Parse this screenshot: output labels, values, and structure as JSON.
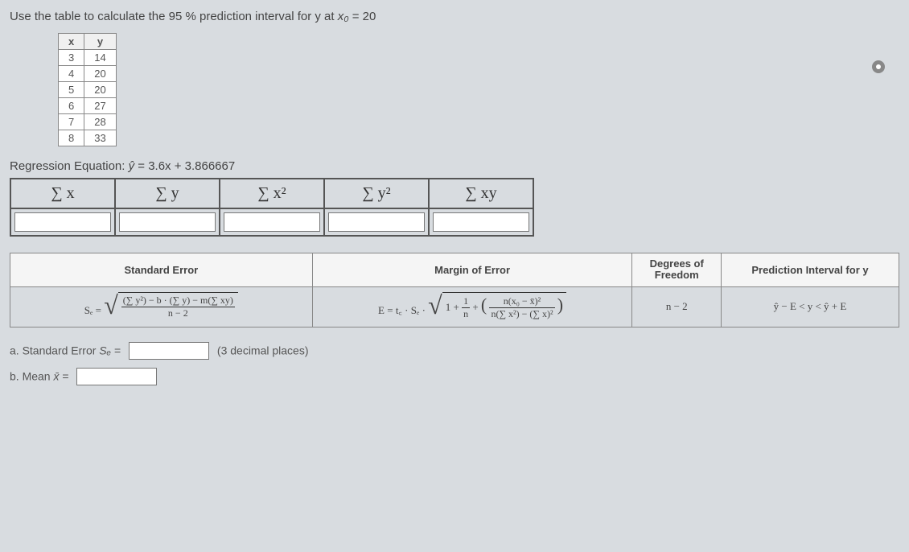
{
  "question": {
    "prefix": "Use the table to calculate the 95 % prediction interval for y at ",
    "var": "x₀",
    "equals": " = 20"
  },
  "data_table": {
    "headers": [
      "x",
      "y"
    ],
    "rows": [
      [
        "3",
        "14"
      ],
      [
        "4",
        "20"
      ],
      [
        "5",
        "20"
      ],
      [
        "6",
        "27"
      ],
      [
        "7",
        "28"
      ],
      [
        "8",
        "33"
      ]
    ]
  },
  "regression": {
    "label": "Regression Equation: ",
    "yhat": "ŷ",
    "equation": " = 3.6x + 3.866667"
  },
  "sums": {
    "headers": [
      "∑ x",
      "∑ y",
      "∑ x²",
      "∑ y²",
      "∑ xy"
    ]
  },
  "formula_headers": {
    "std_error": "Standard Error",
    "margin": "Margin of Error",
    "dof": "Degrees of Freedom",
    "pi": "Prediction Interval for y"
  },
  "formulas": {
    "se_left": "Sₑ =",
    "se_num": "(∑ y²) − b · (∑ y) − m(∑ xy)",
    "se_den": "n − 2",
    "e_left": "E = t꜀ · Sₑ ·",
    "e_inner_left": "1 +",
    "e_inner_frac_num": "1",
    "e_inner_frac_den": "n",
    "e_inner_plus": "+",
    "e_big_num": "n(x₀ − x̄)²",
    "e_big_den": "n(∑ x²) − (∑ x)²",
    "dof": "n − 2",
    "pi": "ŷ − E < y < ŷ + E"
  },
  "answers": {
    "a": {
      "label": "a. Standard Error ",
      "symbol": "Sₑ",
      "equals": " =",
      "hint": "(3 decimal places)"
    },
    "b": {
      "label": "b. Mean ",
      "symbol": "x̄",
      "equals": " ="
    }
  }
}
